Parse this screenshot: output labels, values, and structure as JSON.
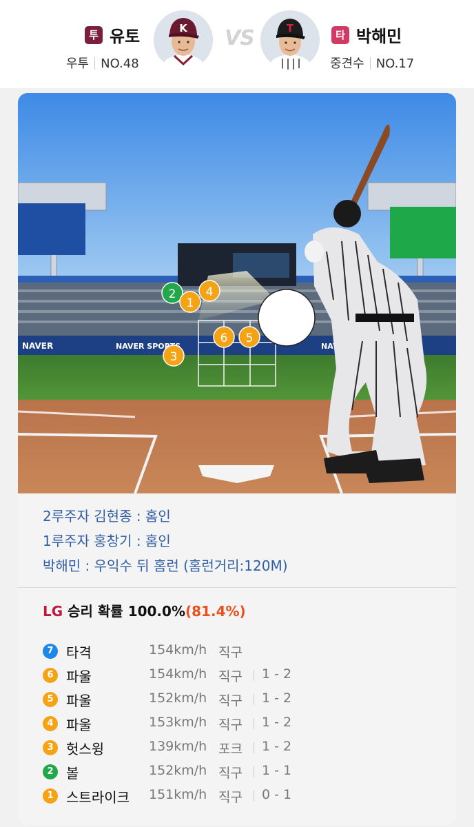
{
  "pitcher": {
    "badge": "투",
    "name": "유토",
    "position": "우투",
    "number": "NO.48",
    "badge_color": "#7a1f3d",
    "avatar": "pitcher-photo"
  },
  "vs_label": "VS",
  "batter": {
    "badge": "타",
    "name": "박해민",
    "position": "중견수",
    "number": "NO.17",
    "badge_color": "#d23a63",
    "avatar": "batter-photo"
  },
  "field": {
    "markers": [
      {
        "label": "2",
        "color": "#22a84a"
      },
      {
        "label": "1",
        "color": "#f5a316"
      },
      {
        "label": "4",
        "color": "#f5a316"
      },
      {
        "label": "6",
        "color": "#f5a316"
      },
      {
        "label": "5",
        "color": "#f5a316"
      },
      {
        "label": "3",
        "color": "#f5a316"
      }
    ],
    "ads": {
      "naver": "NAVER",
      "naver_sports": "NAVER SPORTS"
    }
  },
  "events": [
    "2루주자 김현종 : 홈인",
    "1루주자 홍창기 : 홈인",
    "박해민 : 우익수 뒤 홈런 (홈런거리:120M)"
  ],
  "win_probability": {
    "team": "LG",
    "label": "승리 확률",
    "value": "100.0%",
    "delta": "(81.4%)"
  },
  "pitches": [
    {
      "num": "7",
      "result": "타격",
      "speed": "154km/h",
      "type": "직구",
      "count": "",
      "color": "#1e88e5"
    },
    {
      "num": "6",
      "result": "파울",
      "speed": "154km/h",
      "type": "직구",
      "count": "1 - 2",
      "color": "#f5a316"
    },
    {
      "num": "5",
      "result": "파울",
      "speed": "152km/h",
      "type": "직구",
      "count": "1 - 2",
      "color": "#f5a316"
    },
    {
      "num": "4",
      "result": "파울",
      "speed": "153km/h",
      "type": "직구",
      "count": "1 - 2",
      "color": "#f5a316"
    },
    {
      "num": "3",
      "result": "헛스윙",
      "speed": "139km/h",
      "type": "포크",
      "count": "1 - 2",
      "color": "#f5a316"
    },
    {
      "num": "2",
      "result": "볼",
      "speed": "152km/h",
      "type": "직구",
      "count": "1 - 1",
      "color": "#22a84a"
    },
    {
      "num": "1",
      "result": "스트라이크",
      "speed": "151km/h",
      "type": "직구",
      "count": "0 - 1",
      "color": "#f5a316"
    }
  ]
}
